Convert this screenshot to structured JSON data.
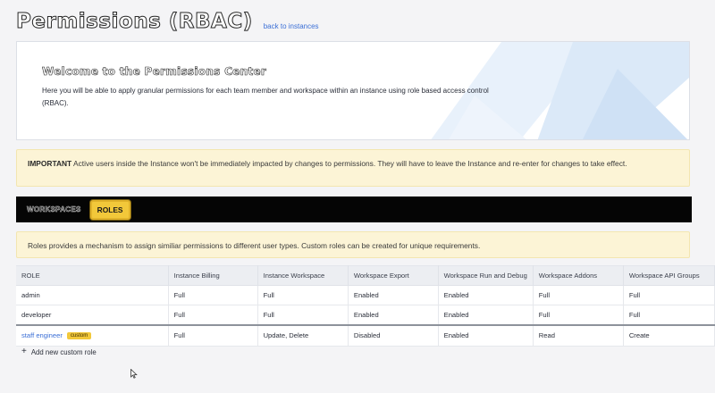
{
  "header": {
    "title": "Permissions (RBAC)",
    "back_link": "back to instances"
  },
  "welcome": {
    "title": "Welcome to the Permissions Center",
    "text": "Here you will be able to apply granular permissions for each team member and workspace within an instance using role based access control (RBAC)."
  },
  "important_notice": {
    "label": "IMPORTANT",
    "text": " Active users inside the Instance won't be immediately impacted by changes to permissions. They will have to leave the Instance and re-enter for changes to take effect."
  },
  "tabs": {
    "workspaces": "WORKSPACES",
    "roles": "ROLES",
    "active": "roles"
  },
  "roles_notice": {
    "text": "Roles provides a mechanism to assign similiar permissions to different user types. Custom roles can be created for unique requirements."
  },
  "table": {
    "headers": [
      "ROLE",
      "Instance Billing",
      "Instance Workspace",
      "Workspace Export",
      "Workspace Run and Debug",
      "Workspace Addons",
      "Workspace API Groups"
    ],
    "rows": [
      {
        "role": "admin",
        "cells": [
          "Full",
          "Full",
          "Enabled",
          "Enabled",
          "Full",
          "Full"
        ]
      },
      {
        "role": "developer",
        "cells": [
          "Full",
          "Full",
          "Enabled",
          "Enabled",
          "Full",
          "Full"
        ]
      },
      {
        "role": "staff engineer",
        "badge": "custom",
        "cells": [
          "Full",
          "Update, Delete",
          "Disabled",
          "Enabled",
          "Read",
          "Create"
        ]
      }
    ]
  },
  "add_role": {
    "label": "Add new custom role",
    "icon": "plus-icon"
  },
  "colors": {
    "accent_yellow": "#f2c83a",
    "link_blue": "#3b6fd6",
    "notice_bg": "#fcf4d6"
  }
}
